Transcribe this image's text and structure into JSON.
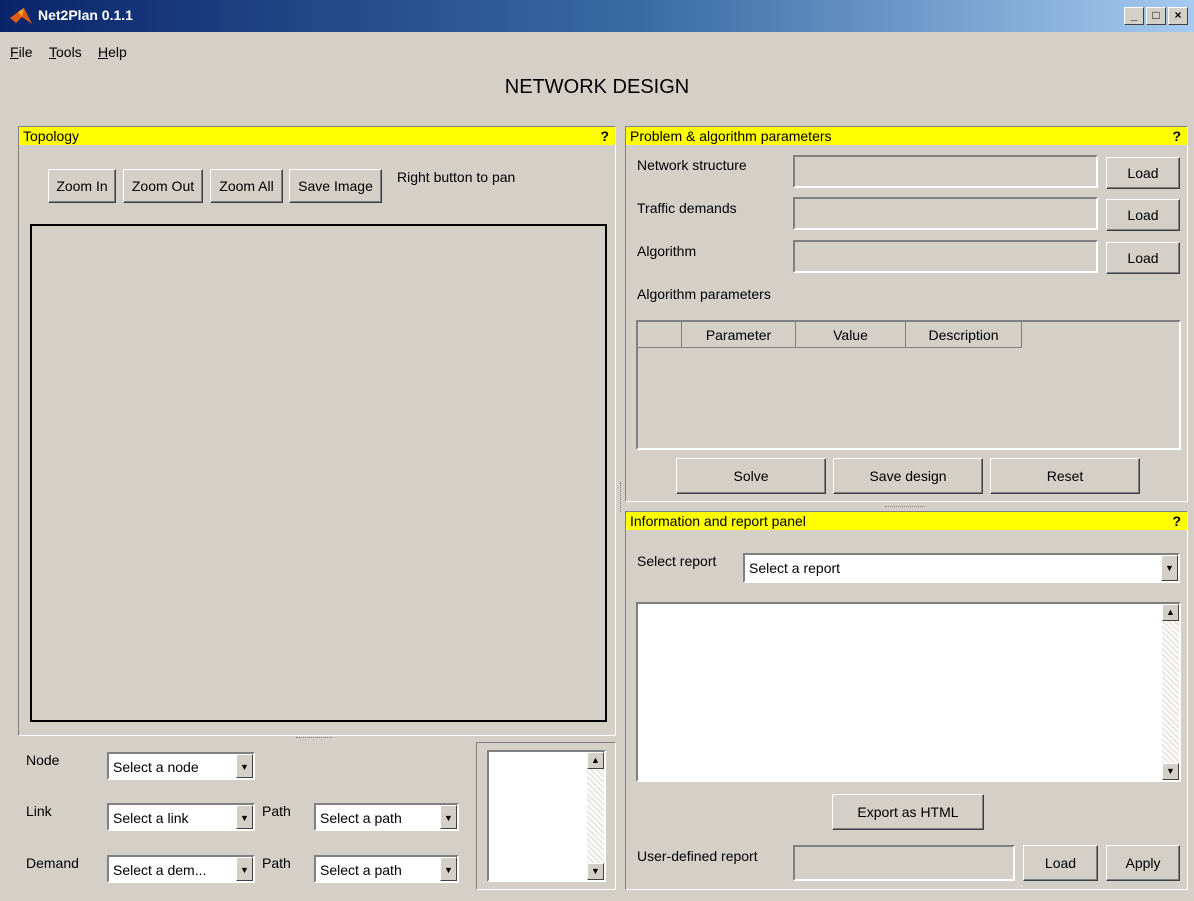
{
  "window": {
    "title": "Net2Plan 0.1.1",
    "min_symbol": "_",
    "max_symbol": "□",
    "close_symbol": "×"
  },
  "menu": [
    {
      "hotkey": "F",
      "rest": "ile"
    },
    {
      "hotkey": "T",
      "rest": "ools"
    },
    {
      "hotkey": "H",
      "rest": "elp"
    }
  ],
  "main_title": "NETWORK DESIGN",
  "topology": {
    "header": "Topology",
    "help": "?",
    "buttons": [
      "Zoom In",
      "Zoom Out",
      "Zoom All",
      "Save Image"
    ],
    "hint": "Right button to pan"
  },
  "selectors": {
    "node_label": "Node",
    "node_value": "Select a node",
    "link_label": "Link",
    "link_value": "Select a link",
    "link_path_label": "Path",
    "link_path_value": "Select a path",
    "demand_label": "Demand",
    "demand_value": "Select a dem...",
    "demand_path_label": "Path",
    "demand_path_value": "Select a path"
  },
  "params": {
    "header": "Problem & algorithm parameters",
    "help": "?",
    "network_structure_label": "Network structure",
    "traffic_demands_label": "Traffic demands",
    "algorithm_label": "Algorithm",
    "load_label": "Load",
    "algorithm_parameters_label": "Algorithm parameters",
    "columns": [
      "",
      "Parameter",
      "Value",
      "Description"
    ],
    "solve": "Solve",
    "save_design": "Save design",
    "reset": "Reset"
  },
  "report": {
    "header": "Information and report panel",
    "help": "?",
    "select_label": "Select report",
    "select_value": "Select a report",
    "export": "Export as HTML",
    "user_defined_label": "User-defined report",
    "load": "Load",
    "apply": "Apply"
  },
  "icons": {
    "up_arrow": "▲",
    "down_arrow": "▼"
  }
}
